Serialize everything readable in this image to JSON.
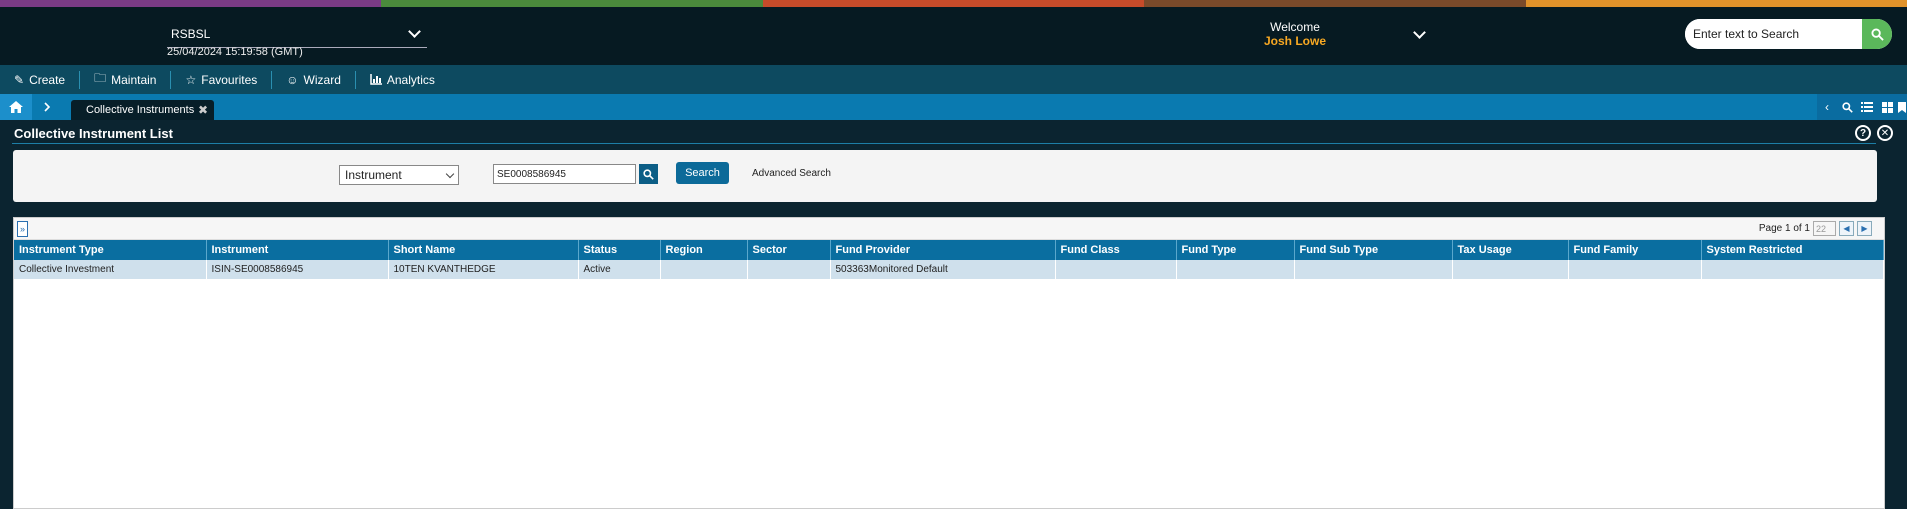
{
  "brand_stripe_colors": [
    "#7a3b86",
    "#4a8a3c",
    "#c64b2a",
    "#7a4a2a",
    "#e0922a"
  ],
  "header": {
    "org": "RSBSL",
    "datetime": "25/04/2024 15:19:58 (GMT)",
    "welcome_label": "Welcome",
    "user_name": "Josh Lowe",
    "search_placeholder": "Enter text to Search"
  },
  "menu": {
    "items": [
      {
        "label": "Create",
        "icon": "edit-icon"
      },
      {
        "label": "Maintain",
        "icon": "folder-icon"
      },
      {
        "label": "Favourites",
        "icon": "star-icon"
      },
      {
        "label": "Wizard",
        "icon": "smile-icon"
      },
      {
        "label": "Analytics",
        "icon": "bar-chart-icon"
      }
    ]
  },
  "tabs": {
    "active": "Collective Instruments"
  },
  "page": {
    "title": "Collective Instrument List",
    "search": {
      "type_selected": "Instrument",
      "query": "SE0008586945",
      "search_label": "Search",
      "advanced_label": "Advanced Search"
    },
    "pager": {
      "text": "Page 1 of 1",
      "page_size": "22"
    },
    "table": {
      "columns": [
        "Instrument Type",
        "Instrument",
        "Short Name",
        "Status",
        "Region",
        "Sector",
        "Fund Provider",
        "Fund Class",
        "Fund Type",
        "Fund Sub Type",
        "Tax Usage",
        "Fund Family",
        "System Restricted"
      ],
      "rows": [
        [
          "Collective Investment",
          "ISIN-SE0008586945",
          "10TEN KVANTHEDGE",
          "Active",
          "",
          "",
          "503363Monitored Default",
          "",
          "",
          "",
          "",
          "",
          ""
        ]
      ]
    }
  }
}
